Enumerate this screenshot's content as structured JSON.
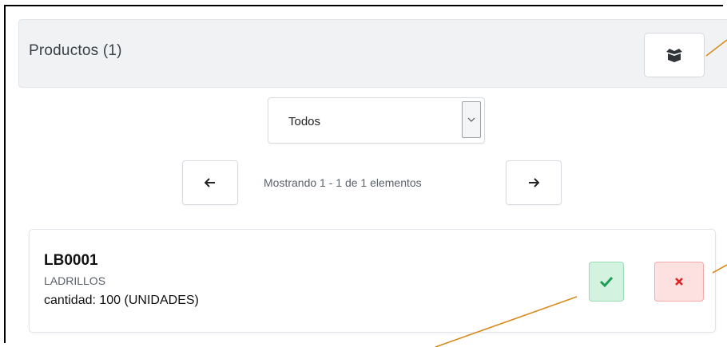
{
  "header": {
    "title": "Productos (1)",
    "box_icon": "box-open-icon"
  },
  "filter": {
    "selected": "Todos"
  },
  "pagination": {
    "prev_icon": "arrow-left-icon",
    "next_icon": "arrow-right-icon",
    "summary": "Mostrando 1 - 1 de 1 elementos"
  },
  "product": {
    "code": "LB0001",
    "name": "LADRILLOS",
    "quantity": "cantidad: 100 (UNIDADES)",
    "confirm_icon": "check-icon",
    "cancel_icon": "close-icon"
  },
  "colors": {
    "confirm": "#1e9e55",
    "cancel": "#e02424",
    "annotation": "#d98a1f"
  }
}
